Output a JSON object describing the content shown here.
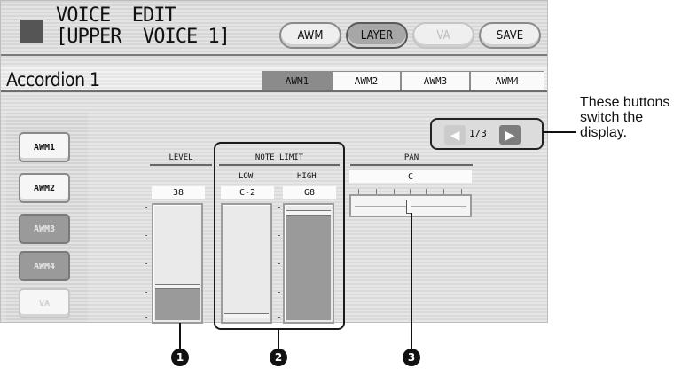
{
  "header": {
    "title_line1": "VOICE  EDIT",
    "title_line2": "[UPPER  VOICE 1]",
    "buttons": [
      {
        "label": "AWM",
        "state": "normal"
      },
      {
        "label": "LAYER",
        "state": "active"
      },
      {
        "label": "VA",
        "state": "disabled"
      },
      {
        "label": "SAVE",
        "state": "normal"
      }
    ]
  },
  "voice_name": "Accordion 1",
  "tabs": [
    {
      "label": "AWM1",
      "active": true
    },
    {
      "label": "AWM2",
      "active": false
    },
    {
      "label": "AWM3",
      "active": false
    },
    {
      "label": "AWM4",
      "active": false
    }
  ],
  "side_buttons": [
    {
      "label": "AWM1",
      "state": "normal"
    },
    {
      "label": "AWM2",
      "state": "normal"
    },
    {
      "label": "AWM3",
      "state": "selected"
    },
    {
      "label": "AWM4",
      "state": "selected"
    },
    {
      "label": "VA",
      "state": "disabled"
    }
  ],
  "page_nav": {
    "indicator": "1/3"
  },
  "params": {
    "level": {
      "header": "LEVEL",
      "value": "38",
      "fill_fraction": 0.29
    },
    "note_limit": {
      "header": "NOTE LIMIT",
      "low": {
        "sub": "LOW",
        "value": "C-2",
        "level_fraction": 0.0
      },
      "high": {
        "sub": "HIGH",
        "value": "G8",
        "level_fraction": 1.0
      }
    },
    "pan": {
      "header": "PAN",
      "value": "C"
    }
  },
  "callouts": [
    "1",
    "2",
    "3"
  ],
  "annotation": "These buttons switch the display."
}
